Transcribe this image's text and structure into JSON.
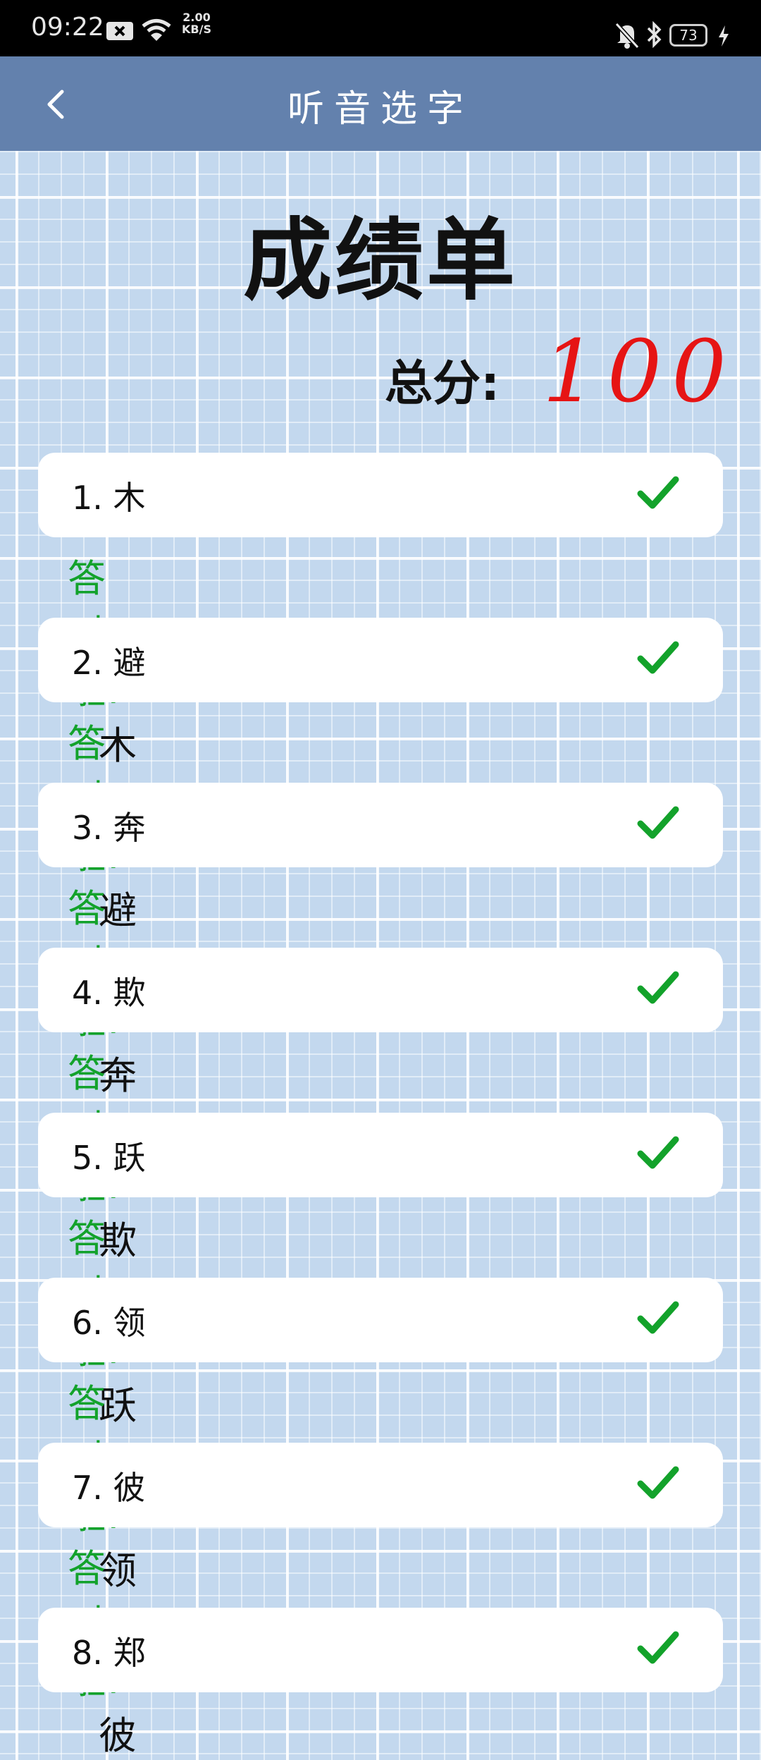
{
  "status_bar": {
    "time": "09:22",
    "net_speed_value": "2.00",
    "net_speed_unit": "KB/S",
    "battery": "73"
  },
  "app_bar": {
    "title": "听音选字"
  },
  "report": {
    "title": "成绩单",
    "score_label": "总分:",
    "score_value": "100"
  },
  "colors": {
    "app_bar": "#6381ad",
    "correct": "#13a22b",
    "score": "#e61414"
  },
  "results": [
    {
      "question": "1. 木",
      "feedback": "答对啦!",
      "answer": "木",
      "correct": true
    },
    {
      "question": "2. 避",
      "feedback": "答对啦!",
      "answer": "避",
      "correct": true
    },
    {
      "question": "3. 奔",
      "feedback": "答对啦!",
      "answer": "奔",
      "correct": true
    },
    {
      "question": "4. 欺",
      "feedback": "答对啦!",
      "answer": "欺",
      "correct": true
    },
    {
      "question": "5. 跃",
      "feedback": "答对啦!",
      "answer": "跃",
      "correct": true
    },
    {
      "question": "6. 领",
      "feedback": "答对啦!",
      "answer": "领",
      "correct": true
    },
    {
      "question": "7. 彼",
      "feedback": "答对啦!",
      "answer": "彼",
      "correct": true
    },
    {
      "question": "8. 郑",
      "correct": true
    }
  ]
}
